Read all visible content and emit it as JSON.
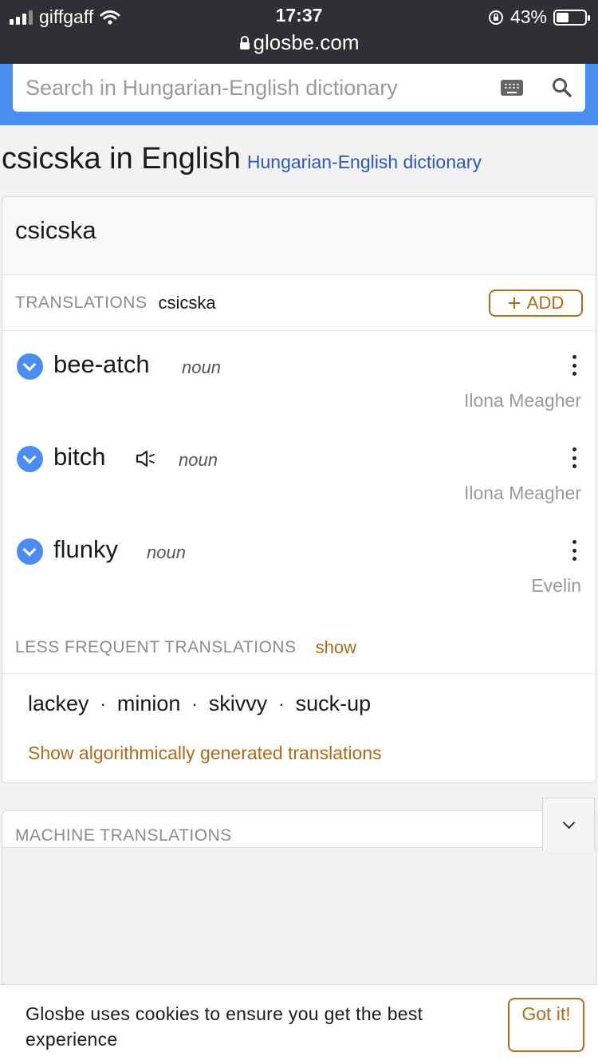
{
  "status_bar": {
    "carrier": "giffgaff",
    "time": "17:37",
    "battery_percent": "43%",
    "battery_level": 0.43,
    "url": "glosbe.com"
  },
  "search": {
    "placeholder": "Search in Hungarian-English dictionary",
    "value": ""
  },
  "header": {
    "title": "csicska in English",
    "dictionary_link": "Hungarian-English dictionary"
  },
  "card": {
    "word": "csicska",
    "translations_label": "TRANSLATIONS",
    "translations_word": "csicska",
    "add_label": "ADD",
    "entries": [
      {
        "word": "bee-atch",
        "pos": "noun",
        "author": "Ilona Meagher",
        "has_audio": false
      },
      {
        "word": "bitch",
        "pos": "noun",
        "author": "Ilona Meagher",
        "has_audio": true
      },
      {
        "word": "flunky",
        "pos": "noun",
        "author": "Evelin",
        "has_audio": false
      }
    ],
    "less_frequent_label": "LESS FREQUENT TRANSLATIONS",
    "show_label": "show",
    "alternatives": [
      "lackey",
      "minion",
      "skivvy",
      "suck-up"
    ],
    "separator": "·",
    "algorithmic_link": "Show algorithmically generated translations"
  },
  "machine": {
    "label": "MACHINE TRANSLATIONS"
  },
  "cookie": {
    "text": "Glosbe uses cookies to ensure you get the best experience",
    "button": "Got it!"
  },
  "colors": {
    "brand_blue": "#4a8cf0",
    "link_blue": "#2b58b8",
    "accent_orange": "#b06a1c"
  }
}
